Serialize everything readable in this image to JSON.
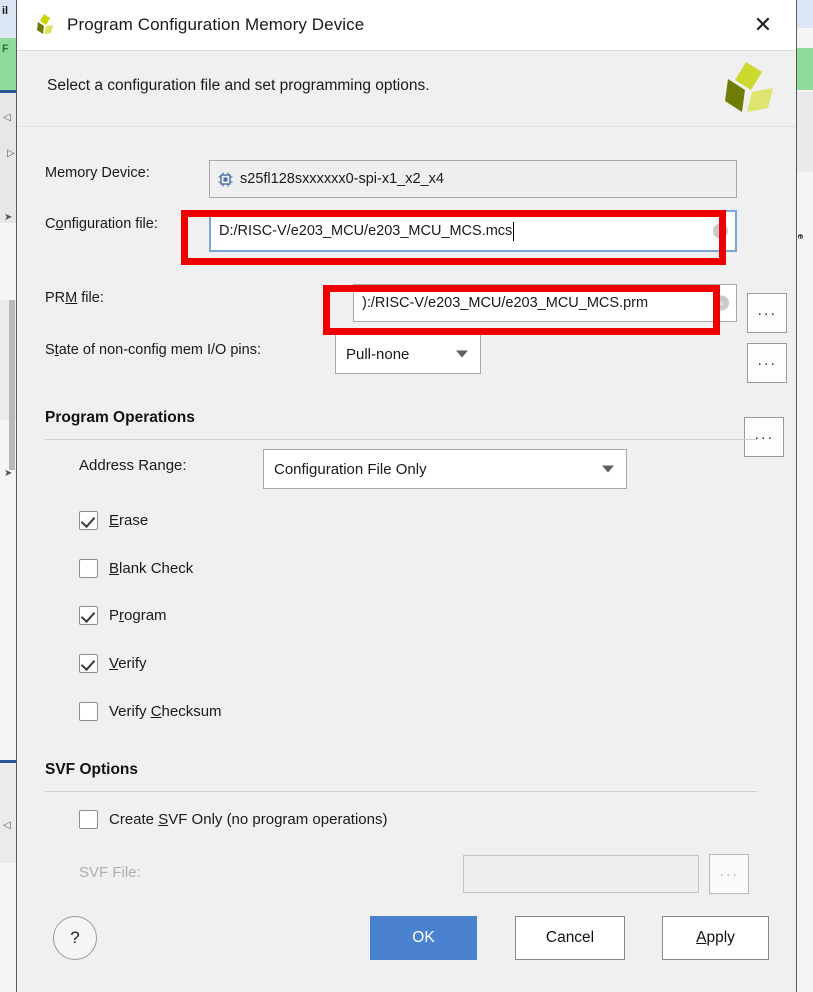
{
  "window": {
    "title": "Program Configuration Memory Device",
    "close_icon": "close-icon",
    "logo_icon": "vivado-logo-icon"
  },
  "header": {
    "instruction": "Select a configuration file and set programming options.",
    "brand_logo_icon": "xilinx-logo-icon"
  },
  "form": {
    "memory_device": {
      "label": "Memory Device:",
      "value": "s25fl128sxxxxxx0-spi-x1_x2_x4",
      "icon": "chip-icon",
      "browse_label": "···"
    },
    "configuration_file": {
      "label_pre": "C",
      "label_mnemonic": "o",
      "label_post": "nfiguration file:",
      "value": "D:/RISC-V/e203_MCU/e203_MCU_MCS.mcs",
      "clear_label": "×",
      "browse_label": "···"
    },
    "prm_file": {
      "label_pre": "PR",
      "label_mnemonic": "M",
      "label_post": " file:",
      "value": "):/RISC-V/e203_MCU/e203_MCU_MCS.prm",
      "clear_label": "×",
      "browse_label": "···"
    },
    "non_config_pins": {
      "label_pre": "S",
      "label_mnemonic": "t",
      "label_post": "ate of non-config mem I/O pins:",
      "value": "Pull-none"
    }
  },
  "program_operations": {
    "title": "Program Operations",
    "address_range": {
      "label": "Address Range:",
      "value": "Configuration File Only"
    },
    "checkboxes": [
      {
        "pre": "",
        "mnemonic": "E",
        "post": "rase",
        "checked": true
      },
      {
        "pre": "",
        "mnemonic": "B",
        "post": "lank Check",
        "checked": false
      },
      {
        "pre": "P",
        "mnemonic": "r",
        "post": "ogram",
        "checked": true
      },
      {
        "pre": "",
        "mnemonic": "V",
        "post": "erify",
        "checked": true
      },
      {
        "pre": "Verify ",
        "mnemonic": "C",
        "post": "hecksum",
        "checked": false
      }
    ]
  },
  "svf_options": {
    "title": "SVF Options",
    "create_svf_only": {
      "pre": "Create ",
      "mnemonic": "S",
      "post": "VF Only (no program operations)",
      "checked": false
    },
    "svf_file": {
      "label": "SVF File:",
      "value": "",
      "browse_label": "···",
      "disabled": true
    }
  },
  "footer": {
    "help_label": "?",
    "ok_label": "OK",
    "cancel_label": "Cancel",
    "apply_pre": "",
    "apply_mnemonic": "A",
    "apply_post": "pply"
  },
  "background_app": {
    "left_text_1": "il",
    "left_text_2": "F"
  },
  "colors": {
    "accent_primary": "#4a82d0",
    "annotation": "#ee0000",
    "focus_border": "#7aa6dd",
    "brand_green": "#c8d400",
    "brand_dark_green": "#6b7a00"
  }
}
